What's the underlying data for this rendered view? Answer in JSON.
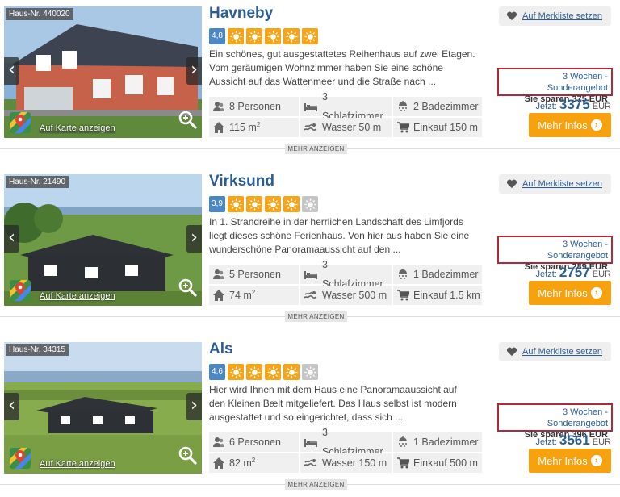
{
  "listings": [
    {
      "haus_nr": "Haus-Nr. 440020",
      "title": "Havneby",
      "rating": "4,8",
      "suns_filled": 5,
      "description": "Ein schönes, gut ausgestattetes Reihenhaus auf zwei Etagen. Vom geräumigen Wohnzimmer haben Sie eine schöne Aussicht auf das Wattenmeer und die Straße nach ...",
      "personen": "8 Personen",
      "schlafzimmer": "3 Schlafzimmer",
      "badezimmer": "2 Badezimmer",
      "flaeche": "115 m",
      "wasser": "Wasser 50 m",
      "einkauf": "Einkauf 150 m",
      "offer_line1": "3 Wochen - Sonderangebot",
      "offer_line2": "Sie sparen 375 EUR",
      "price_prefix": "Jetzt:",
      "price": "3375",
      "currency": "EUR"
    },
    {
      "haus_nr": "Haus-Nr. 21490",
      "title": "Virksund",
      "rating": "3,9",
      "suns_filled": 4,
      "description": "In 1. Strandreihe in der herrlichen Landschaft des Limfjords liegt dieses schöne Ferienhaus. Von hier aus haben Sie eine wunderschöne Panoramaaussicht auf den ...",
      "personen": "5 Personen",
      "schlafzimmer": "3 Schlafzimmer",
      "badezimmer": "1 Badezimmer",
      "flaeche": "74 m",
      "wasser": "Wasser 500 m",
      "einkauf": "Einkauf 1.5 km",
      "offer_line1": "3 Wochen - Sonderangebot",
      "offer_line2": "Sie sparen 289 EUR",
      "price_prefix": "Jetzt:",
      "price": "2757",
      "currency": "EUR"
    },
    {
      "haus_nr": "Haus-Nr. 34315",
      "title": "Als",
      "rating": "4,6",
      "suns_filled": 4,
      "description": "Hier wird Ihnen mit dem Haus eine Panoramaaussicht auf den Kleinen Bælt mitgeliefert. Das Haus selbst ist modern ausgestattet und so eingerichtet, dass sich ...",
      "personen": "6 Personen",
      "schlafzimmer": "3 Schlafzimmer",
      "badezimmer": "1 Badezimmer",
      "flaeche": "82 m",
      "wasser": "Wasser 150 m",
      "einkauf": "Einkauf 500 m",
      "offer_line1": "3 Wochen - Sonderangebot",
      "offer_line2": "Sie sparen 396 EUR",
      "price_prefix": "Jetzt:",
      "price": "3561",
      "currency": "EUR"
    }
  ],
  "labels": {
    "map_link": "Auf Karte anzeigen",
    "merkliste": "Auf Merkliste setzen",
    "mehr_infos": "Mehr Infos",
    "mehr_anzeigen": "MEHR ANZEIGEN",
    "area_unit_sup": "2",
    "prev_arrow": "‹",
    "next_arrow": "›",
    "info_arrow": "›"
  },
  "colors": {
    "accent_blue": "#2a5d96",
    "orange": "#f7a10f",
    "offer_border": "#b5283a",
    "rating_badge": "#4b87c4"
  },
  "icons": [
    "person-icon",
    "bed-icon",
    "shower-icon",
    "house-icon",
    "water-icon",
    "cart-icon",
    "heart-icon",
    "map-pin-icon",
    "zoom-icon",
    "sun-icon"
  ]
}
